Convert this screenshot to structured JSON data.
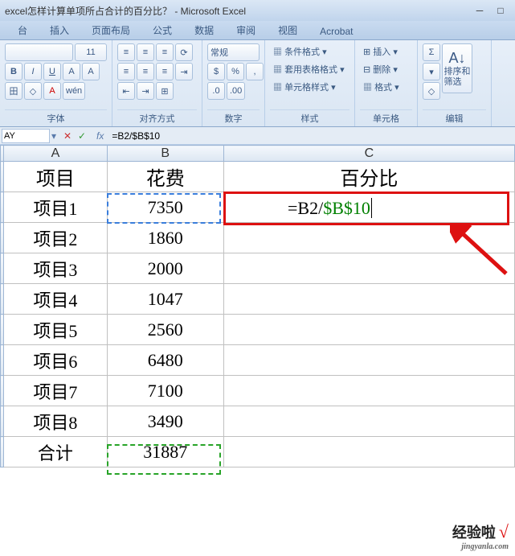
{
  "window": {
    "title": "excel怎样计算单项所占合计的百分比？ - Microsoft Excel"
  },
  "ribbon_tabs": [
    "台",
    "插入",
    "页面布局",
    "公式",
    "数据",
    "审阅",
    "视图",
    "Acrobat"
  ],
  "ribbon": {
    "font": {
      "size": "11",
      "bold": "B",
      "italic": "I",
      "underline": "U",
      "ai": "A",
      "a": "A",
      "border": "田",
      "fill": "◇",
      "font_color": "A",
      "wen": "wén",
      "label": "字体"
    },
    "align": {
      "label": "对齐方式"
    },
    "number": {
      "type": "常规",
      "label": "数字"
    },
    "styles": {
      "cond": "条件格式",
      "table": "套用表格格式",
      "cell": "单元格样式",
      "label": "样式"
    },
    "cells": {
      "insert": "插入",
      "delete": "删除",
      "format": "格式",
      "label": "单元格"
    },
    "edit": {
      "sort": "排序和\n筛选",
      "label": "编辑",
      "sigma": "Σ"
    }
  },
  "formula_bar": {
    "namebox": "AY",
    "formula": "=B2/$B$10"
  },
  "columns": [
    "A",
    "B",
    "C"
  ],
  "rows": [
    {
      "a": "项目",
      "b": "花费",
      "c": "百分比"
    },
    {
      "a": "项目1",
      "b": "7350",
      "c": ""
    },
    {
      "a": "项目2",
      "b": "1860",
      "c": ""
    },
    {
      "a": "项目3",
      "b": "2000",
      "c": ""
    },
    {
      "a": "项目4",
      "b": "1047",
      "c": ""
    },
    {
      "a": "项目5",
      "b": "2560",
      "c": ""
    },
    {
      "a": "项目6",
      "b": "6480",
      "c": ""
    },
    {
      "a": "项目7",
      "b": "7100",
      "c": ""
    },
    {
      "a": "项目8",
      "b": "3490",
      "c": ""
    },
    {
      "a": "合计",
      "b": "31887",
      "c": ""
    }
  ],
  "active_cell_formula": {
    "prefix": "=B2/",
    "abs": "$B$10"
  },
  "watermark": {
    "main": "经验啦",
    "sub": "jingyanla.com"
  }
}
